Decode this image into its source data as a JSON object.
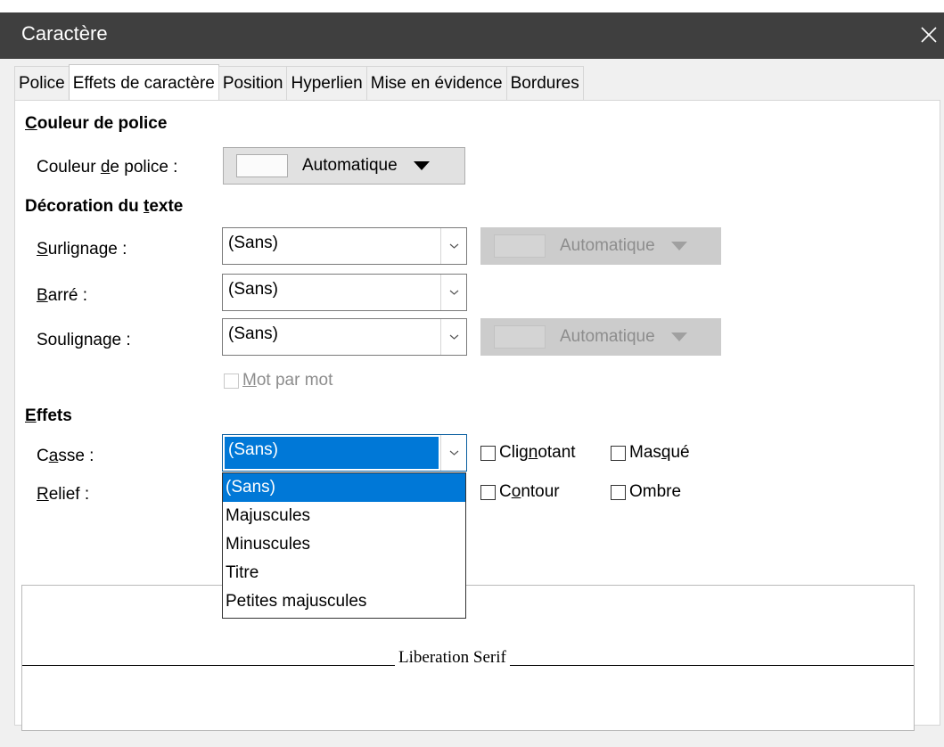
{
  "window": {
    "title": "Caractère"
  },
  "tabs": [
    "Police",
    "Effets de caractère",
    "Position",
    "Hyperlien",
    "Mise en évidence",
    "Bordures"
  ],
  "active_tab": "Effets de caractère",
  "font_color": {
    "heading_first": "C",
    "heading_rest": "ouleur de police",
    "label_pre": "Couleur ",
    "label_acc": "d",
    "label_post": "e police :",
    "value": "Automatique"
  },
  "text_decoration": {
    "heading_pre": "Décoration du ",
    "heading_acc": "t",
    "heading_post": "exte",
    "overline": {
      "label_acc": "S",
      "label_post": "urlignage :",
      "value": "(Sans)",
      "color": "Automatique"
    },
    "strikethrough": {
      "label_acc": "B",
      "label_post": "arré :",
      "value": "(Sans)"
    },
    "underline": {
      "label_pre": "Souli",
      "label_acc": "g",
      "label_post": "nage :",
      "value": "(Sans)",
      "color": "Automatique"
    },
    "word_by_word": {
      "label_acc": "M",
      "label_post": "ot par mot",
      "checked": false,
      "disabled": true
    }
  },
  "effects": {
    "heading_acc": "E",
    "heading_post": "ffets",
    "case": {
      "label_pre": "C",
      "label_acc": "a",
      "label_post": "sse :",
      "value": "(Sans)"
    },
    "relief": {
      "label_acc": "R",
      "label_post": "elief :"
    },
    "blinking": {
      "label_pre": "Clig",
      "label_acc": "n",
      "label_post": "otant",
      "checked": false
    },
    "hidden": {
      "label_pre": "Mas",
      "label_acc": "q",
      "label_post": "ué",
      "checked": false
    },
    "outline": {
      "label_pre": "C",
      "label_acc": "o",
      "label_post": "ntour",
      "checked": false
    },
    "shadow": {
      "label_pre": "",
      "label_acc": "",
      "label_post": "Ombre",
      "checked": false
    }
  },
  "case_dropdown": {
    "options": [
      "(Sans)",
      "Majuscules",
      "Minuscules",
      "Titre",
      "Petites majuscules"
    ],
    "selected": "(Sans)"
  },
  "preview": {
    "text": "Liberation Serif"
  }
}
